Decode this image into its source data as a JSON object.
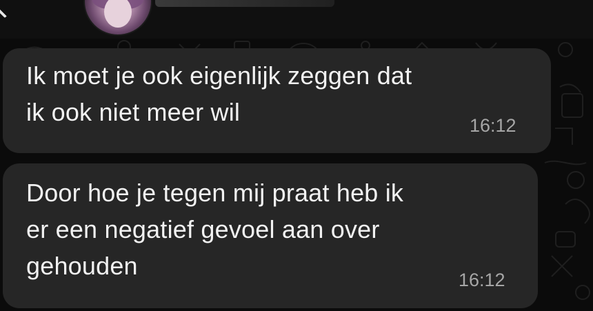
{
  "header": {
    "avatar_icon": "contact-avatar-icon",
    "back_icon": "chevron-left-icon"
  },
  "messages": [
    {
      "lines": [
        "Ik moet je ook eigenlijk zeggen dat",
        "ik ook niet meer wil"
      ],
      "time": "16:12"
    },
    {
      "lines": [
        "Door hoe je tegen mij praat heb ik",
        "er een negatief gevoel aan over",
        "gehouden"
      ],
      "time": "16:12"
    }
  ],
  "colors": {
    "background": "#0b0b0b",
    "bubble": "#262626",
    "text": "#f2f2f2",
    "timestamp": "#a6a6a6"
  }
}
